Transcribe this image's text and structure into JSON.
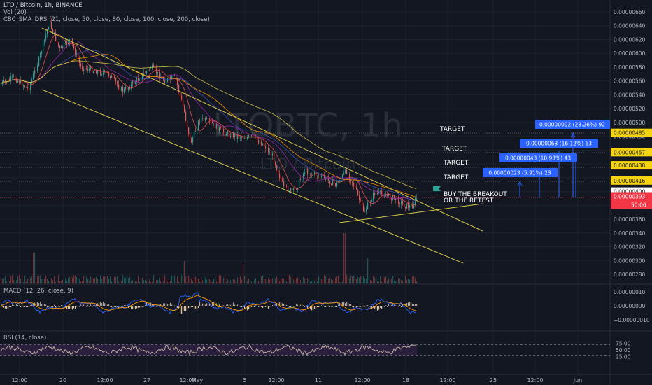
{
  "header": {
    "symbol_line": "LTO / Bitcoin, 1h, BINANCE",
    "volume_line": "Vol (20)",
    "ma_line": "CBC_SMA_DRS (21, close, 50, close, 80, close, 100, close, 200, close)"
  },
  "watermark": {
    "symbol": "LTOBTC, 1h",
    "name": "LTO / Bitcoin"
  },
  "panes": {
    "macd_label": "MACD (12, 26, close, 9)",
    "rsi_label": "RSI (14, close)"
  },
  "colors": {
    "background": "#131722",
    "up": "#26a69a",
    "down": "#ef5350",
    "trendline": "#d4c64a",
    "target_box": "#2962ff",
    "price_tag": "#f5d40f",
    "last_price": "#f23645",
    "rsi_band": "#2a1f3d",
    "rsi_line": "#c9b8a6",
    "macd_line": "#2962ff",
    "signal_line": "#ff9800"
  },
  "annotations": {
    "targets": [
      "TARGET",
      "TARGET",
      "TARGET",
      "TARGET"
    ],
    "buy_text_1": "BUY THE BREAKOUT",
    "buy_text_2": "OR THE RETEST",
    "measure_boxes": [
      "0.00000023 (5.91%) 23",
      "0.00000043 (10.93%) 43",
      "0.00000063 (16.12%) 63",
      "0.00000092 (23.26%) 92"
    ]
  },
  "chart_data": {
    "type": "candlestick",
    "title": "LTO / Bitcoin, 1h, BINANCE",
    "price_axis": {
      "ticks": [
        "0.00000660",
        "0.00000640",
        "0.00000620",
        "0.00000600",
        "0.00000580",
        "0.00000560",
        "0.00000540",
        "0.00000520",
        "0.00000500",
        "0.00000480",
        "0.00000460",
        "0.00000440",
        "0.00000420",
        "0.00000400",
        "0.00000380",
        "0.00000360",
        "0.00000340",
        "0.00000320",
        "0.00000300",
        "0.00000280"
      ],
      "range": [
        2.7e-06,
        6.7e-06
      ]
    },
    "time_axis": {
      "ticks": [
        "12:00",
        "20",
        "12:00",
        "27",
        "12:00",
        "May",
        "5",
        "12:00",
        "11",
        "12:00",
        "18",
        "12:00",
        "25",
        "12:00",
        "Jun"
      ]
    },
    "price_tags": [
      {
        "label": "0.00000485",
        "value": 4.85e-06
      },
      {
        "label": "0.00000457",
        "value": 4.57e-06
      },
      {
        "label": "0.00000438",
        "value": 4.38e-06
      },
      {
        "label": "0.00000416",
        "value": 4.16e-06
      },
      {
        "label": "0.00000400",
        "value": 4e-06
      }
    ],
    "last_price": {
      "label": "0.00000393",
      "countdown": "50:06",
      "value": 3.93e-06
    },
    "price_path": [
      [
        0,
        5.55e-06
      ],
      [
        20,
        5.65e-06
      ],
      [
        40,
        5.48e-06
      ],
      [
        55,
        5.9e-06
      ],
      [
        70,
        6.45e-06
      ],
      [
        85,
        6.05e-06
      ],
      [
        100,
        6.2e-06
      ],
      [
        115,
        5.8e-06
      ],
      [
        135,
        5.75e-06
      ],
      [
        155,
        5.7e-06
      ],
      [
        175,
        5.45e-06
      ],
      [
        200,
        5.65e-06
      ],
      [
        215,
        5.8e-06
      ],
      [
        235,
        5.6e-06
      ],
      [
        250,
        5.65e-06
      ],
      [
        262,
        5.2e-06
      ],
      [
        272,
        4.7e-06
      ],
      [
        285,
        5.05e-06
      ],
      [
        300,
        5e-06
      ],
      [
        320,
        4.85e-06
      ],
      [
        340,
        4.8e-06
      ],
      [
        360,
        4.78e-06
      ],
      [
        375,
        4.7e-06
      ],
      [
        390,
        4.5e-06
      ],
      [
        405,
        4.05e-06
      ],
      [
        420,
        4e-06
      ],
      [
        435,
        4.3e-06
      ],
      [
        450,
        4.25e-06
      ],
      [
        465,
        4.18e-06
      ],
      [
        480,
        4.1e-06
      ],
      [
        495,
        4.3e-06
      ],
      [
        505,
        4.1e-06
      ],
      [
        520,
        3.7e-06
      ],
      [
        535,
        3.98e-06
      ],
      [
        550,
        3.95e-06
      ],
      [
        565,
        3.9e-06
      ],
      [
        578,
        3.8e-06
      ],
      [
        588,
        3.78e-06
      ],
      [
        596,
        3.93e-06
      ]
    ],
    "volume_spikes": [
      [
        48,
        0.55
      ],
      [
        262,
        0.4
      ],
      [
        492,
        0.9
      ],
      [
        525,
        0.45
      ],
      [
        347,
        0.35
      ]
    ],
    "rsi_levels": {
      "upper": 70,
      "lower": 30,
      "ticks": [
        "75.00",
        "50.00",
        "25.00"
      ]
    },
    "macd_ticks": [
      "0.00000010",
      "0.00000000",
      "−0.00000010"
    ]
  }
}
